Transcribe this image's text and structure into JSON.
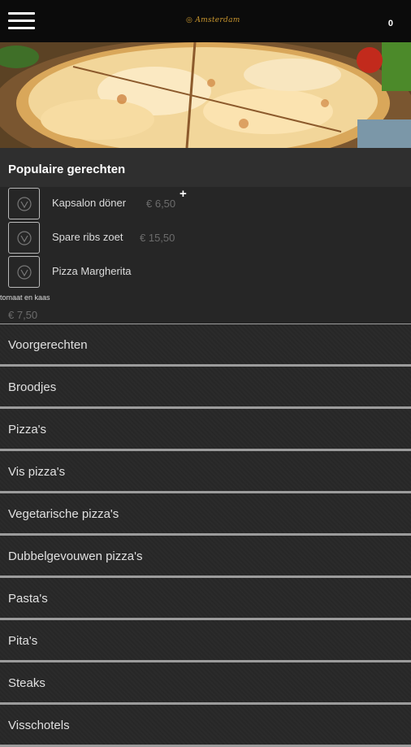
{
  "header": {
    "logo_text": "Amsterdam",
    "cart_count": "0"
  },
  "popular": {
    "title": "Populaire gerechten",
    "items": [
      {
        "name": "Kapsalon döner",
        "price": "€ 6,50"
      },
      {
        "name": "Spare ribs zoet",
        "price": "€ 15,50"
      },
      {
        "name": "Pizza Margherita",
        "description": "tomaat en kaas",
        "price": "€ 7,50"
      }
    ],
    "add_label": "+"
  },
  "categories": [
    "Voorgerechten",
    "Broodjes",
    "Pizza's",
    "Vis pizza's",
    "Vegetarische pizza's",
    "Dubbelgevouwen pizza's",
    "Pasta's",
    "Pita's",
    "Steaks",
    "Visschotels"
  ],
  "colors": {
    "accent": "#c9962e",
    "topbar": "#0b0b0b",
    "divider": "#9c9c9c"
  },
  "icons": {
    "menu": "hamburger-icon",
    "thumb": "dish-placeholder-icon"
  }
}
